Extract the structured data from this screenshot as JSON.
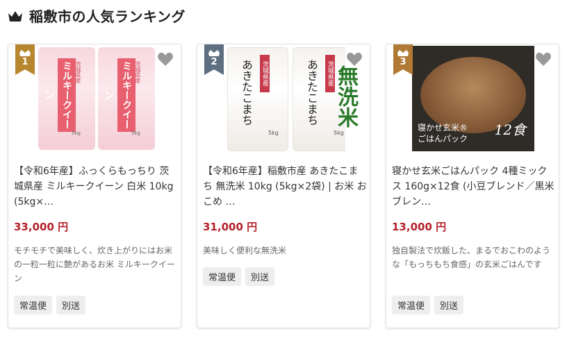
{
  "header": {
    "title": "稲敷市の人気ランキング",
    "icon": "crown-icon"
  },
  "colors": {
    "price": "#b3202a",
    "gold": "#b8862f",
    "silver": "#5f6f82",
    "bronze": "#b07a35"
  },
  "products": [
    {
      "rank": "1",
      "name": "【令和6年産】ふっくらもっちり 茨城県産 ミルキークイーン 白米 10kg (5kg×…",
      "price": "33,000 円",
      "description": "モチモチで美味しく、炊き上がりにはお米の一粒一粒に艶があるお米 ミルキークイーン",
      "tags": [
        "常温便",
        "別送"
      ],
      "image": {
        "brand_text": "ミルキークイーン",
        "pref_text": "茨城県産",
        "weight": "5kg"
      }
    },
    {
      "rank": "2",
      "name": "【令和6年産】稲敷市産 あきたこまち 無洗米 10kg (5kg×2袋) | お米 おこめ …",
      "price": "31,000 円",
      "description": "美味しく便利な無洗米",
      "tags": [
        "常温便",
        "別送"
      ],
      "image": {
        "brand_text": "あきたこまち",
        "pref_text": "茨城県産",
        "weight": "5kg",
        "badge_text": "無洗米"
      }
    },
    {
      "rank": "3",
      "name": "寝かせ玄米ごはんパック 4種ミックス 160g×12食 (小豆ブレンド／黒米ブレン…",
      "price": "13,000 円",
      "description": "独自製法で炊飯した、まるでおこわのような「もっちもち食感」の玄米ごはんです",
      "tags": [
        "常温便",
        "別送"
      ],
      "image": {
        "caption_line1": "寝かせ玄米®",
        "caption_line2": "ごはんパック",
        "count": "12食"
      }
    }
  ]
}
